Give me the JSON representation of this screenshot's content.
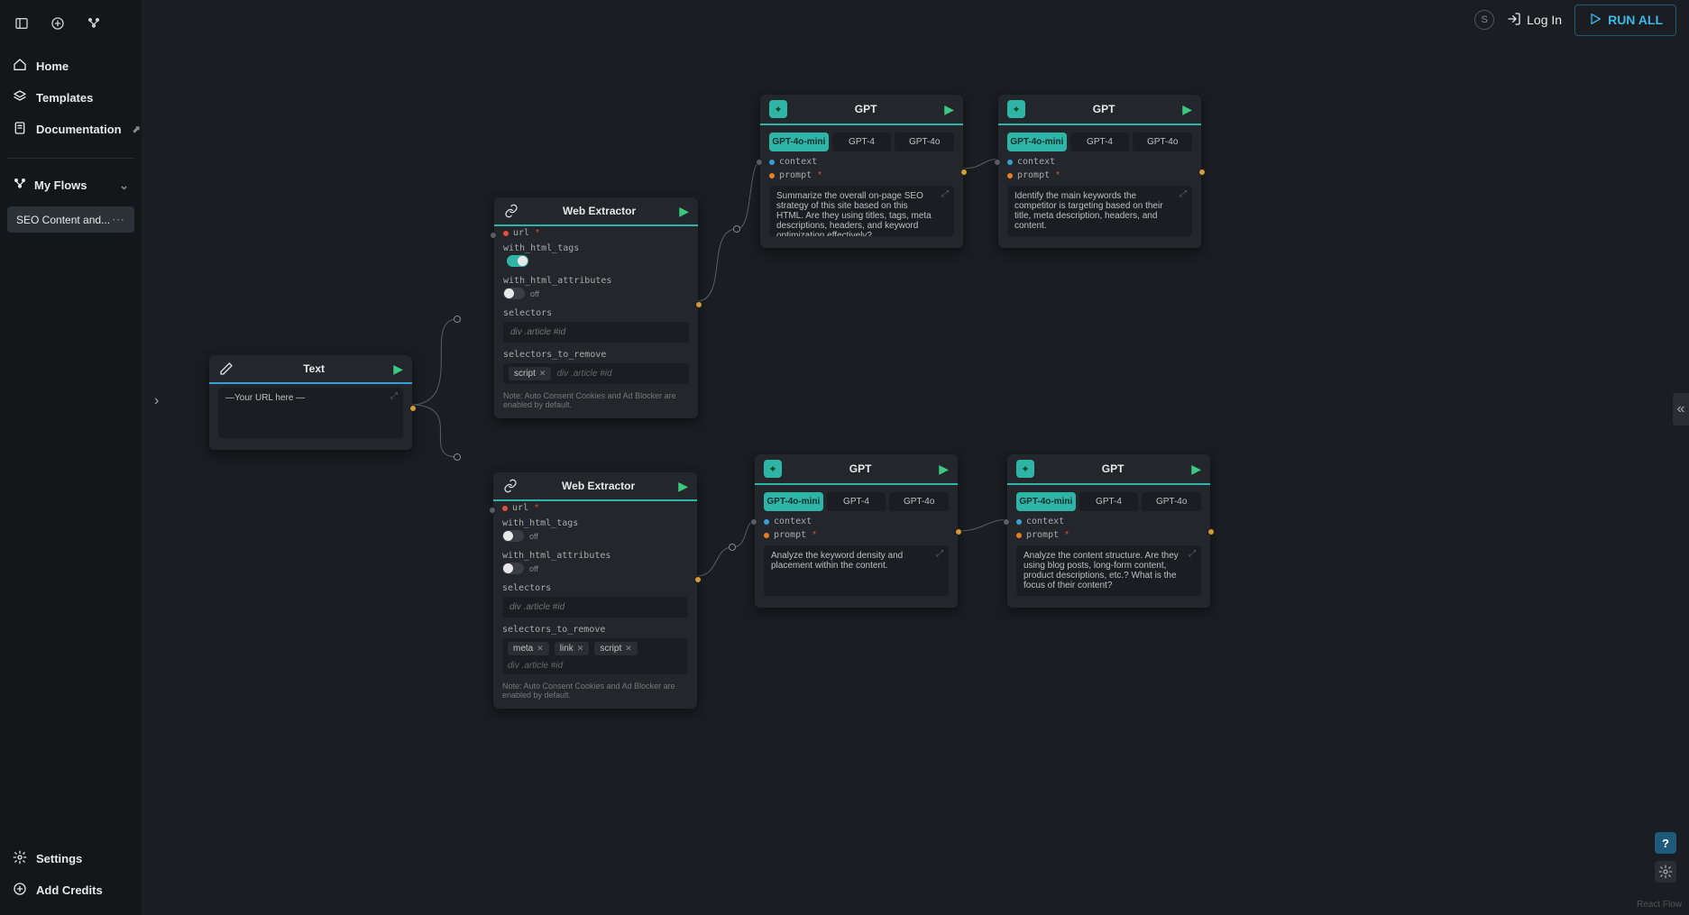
{
  "sidebar": {
    "nav": {
      "home": "Home",
      "templates": "Templates",
      "documentation": "Documentation"
    },
    "section_title": "My Flows",
    "flow_item": "SEO Content and...",
    "settings": "Settings",
    "add_credits": "Add Credits"
  },
  "topbar": {
    "login": "Log In",
    "run_all": "RUN ALL"
  },
  "canvas_footer": "React Flow",
  "nodes": {
    "text1": {
      "title": "Text",
      "value": "—Your URL here —"
    },
    "web1": {
      "title": "Web Extractor",
      "url_label": "url",
      "with_html_tags": "with_html_tags",
      "with_html_attributes": "with_html_attributes",
      "toggle_on": "on",
      "toggle_off": "off",
      "selectors": "selectors",
      "selectors_placeholder": "div .article #id",
      "selectors_remove": "selectors_to_remove",
      "chips": [
        "script"
      ],
      "note": "Note: Auto Consent Cookies and Ad Blocker are enabled by default."
    },
    "web2": {
      "title": "Web Extractor",
      "url_label": "url",
      "with_html_tags": "with_html_tags",
      "with_html_attributes": "with_html_attributes",
      "toggle_off_label": "off",
      "selectors": "selectors",
      "selectors_placeholder": "div .article #id",
      "selectors_remove": "selectors_to_remove",
      "chips": [
        "meta",
        "link",
        "script"
      ],
      "note": "Note: Auto Consent Cookies and Ad Blocker are enabled by default."
    },
    "gpt_tabs": {
      "mini": "GPT-4o-mini",
      "gpt4": "GPT-4",
      "gpt4o": "GPT-4o"
    },
    "gpt_port": {
      "context": "context",
      "prompt": "prompt"
    },
    "gpt1": {
      "title": "GPT",
      "prompt": "Summarize the overall on-page SEO strategy of this site based on this HTML. Are they using titles, tags, meta descriptions, headers, and keyword optimization effectively?"
    },
    "gpt2": {
      "title": "GPT",
      "prompt": "Identify the main keywords the competitor is targeting based on their title, meta description, headers, and content."
    },
    "gpt3": {
      "title": "GPT",
      "prompt": "Analyze the keyword density and placement within the content."
    },
    "gpt4": {
      "title": "GPT",
      "prompt": "Analyze the content structure. Are they using blog posts, long-form content, product descriptions, etc.? What is the focus of their content?"
    }
  }
}
